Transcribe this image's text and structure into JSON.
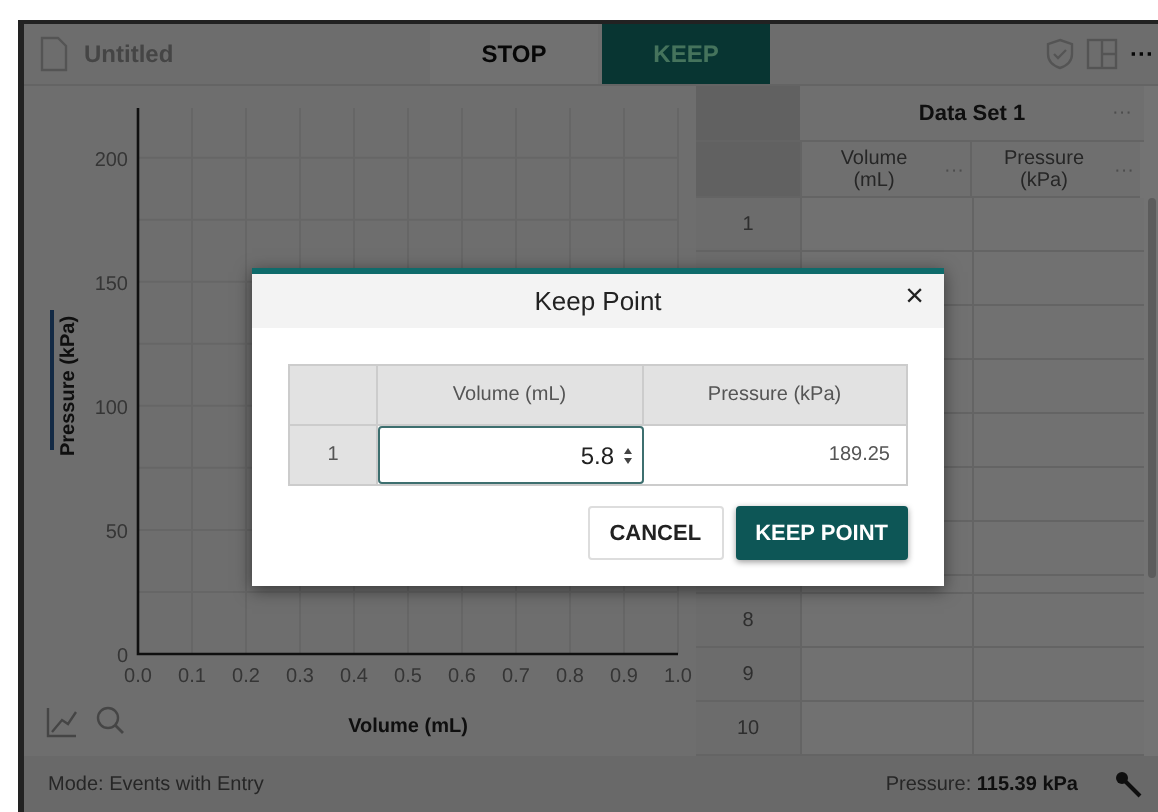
{
  "toolbar": {
    "file_name": "Untitled",
    "buttons": [
      {
        "label": "STOP",
        "selected": false
      },
      {
        "label": "KEEP",
        "selected": true
      }
    ],
    "more": "···"
  },
  "graph": {
    "chart_data": {
      "type": "scatter",
      "xlabel": "Volume (mL)",
      "ylabel": "Pressure (kPa)",
      "xlim": [
        0,
        1
      ],
      "ylim": [
        0,
        220
      ],
      "xticks": [
        {
          "value": 0,
          "label": "0.0"
        },
        {
          "value": 0.1,
          "label": "0.1"
        },
        {
          "value": 0.2,
          "label": "0.2"
        },
        {
          "value": 0.3,
          "label": "0.3"
        },
        {
          "value": 0.4,
          "label": "0.4"
        },
        {
          "value": 0.5,
          "label": "0.5"
        },
        {
          "value": 0.6,
          "label": "0.6"
        },
        {
          "value": 0.7,
          "label": "0.7"
        },
        {
          "value": 0.8,
          "label": "0.8"
        },
        {
          "value": 0.9,
          "label": "0.9"
        },
        {
          "value": 1,
          "label": "1.0"
        }
      ],
      "yticks": [
        0,
        50,
        100,
        150,
        200
      ],
      "grid": true
    }
  },
  "data_table": {
    "title": "Data Set 1",
    "menu": "···",
    "columns": [
      {
        "label": "Volume (mL)",
        "menu": "···"
      },
      {
        "label": "Pressure (kPa)",
        "menu": "···"
      }
    ],
    "top_rows": [
      "1"
    ],
    "bottom_rows": [
      "8",
      "9",
      "10"
    ]
  },
  "status_bar": {
    "mode": "Mode: Events with Entry",
    "reading_label": "Pressure:",
    "reading_value": "115.39 kPa"
  },
  "dialog": {
    "title": "Keep Point",
    "close": "×",
    "columns": [
      "Volume (mL)",
      "Pressure (kPa)"
    ],
    "row": {
      "label": "1",
      "volume": "5.8",
      "pressure": "189.25"
    },
    "buttons": [
      {
        "label": "CANCEL",
        "kind": "secondary"
      },
      {
        "label": "KEEP POINT",
        "kind": "primary"
      }
    ]
  }
}
